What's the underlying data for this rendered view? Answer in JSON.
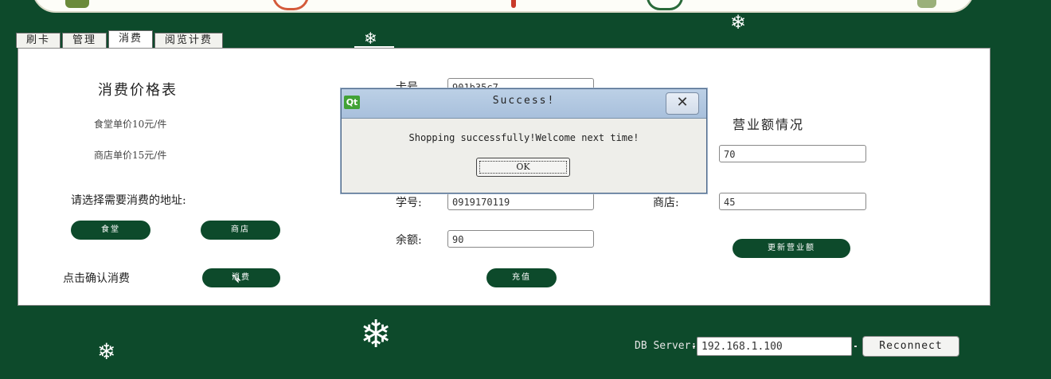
{
  "tabs": [
    "刷卡",
    "管理",
    "消费",
    "阅览计费"
  ],
  "active_tab": "消费",
  "price_table": {
    "title": "消费价格表",
    "canteen": "食堂单价10元/件",
    "shop": "商店单价15元/件"
  },
  "location": {
    "prompt": "请选择需要消费的地址:",
    "canteen_button": "食堂",
    "shop_button": "商店"
  },
  "confirm": {
    "label": "点击确认消费",
    "button": "消费"
  },
  "card": {
    "card_no_label": "卡号",
    "card_no_value": "901b35c7",
    "student_id_label": "学号:",
    "student_id_value": "0919170119",
    "balance_label": "余额:",
    "balance_value": "90",
    "recharge_button": "充值"
  },
  "revenue": {
    "title": "营业额情况",
    "canteen_value": "70",
    "shop_label": "商店:",
    "shop_value": "45",
    "update_button": "更新营业额"
  },
  "dialog": {
    "title": "Success!",
    "message": "Shopping successfully!Welcome next time!",
    "ok_label": "OK",
    "close_glyph": "✕",
    "logo": "Qt"
  },
  "db": {
    "label": "DB Server:",
    "server_value": "192.168.1.100",
    "reconnect_label": "Reconnect"
  },
  "icons": {
    "snowflake": "❄",
    "cursor": "➶"
  },
  "colors": {
    "background": "#0d4a2b",
    "panel": "#ffffff",
    "button": "#0d4a2b"
  }
}
